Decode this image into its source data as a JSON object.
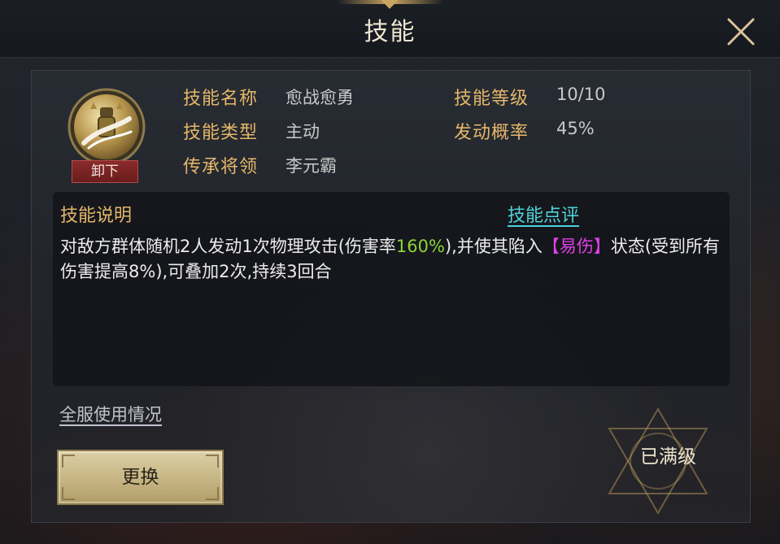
{
  "header": {
    "title": "技能"
  },
  "skill": {
    "unequip_label": "卸下",
    "fields": [
      {
        "label": "技能名称",
        "value": "愈战愈勇"
      },
      {
        "label": "技能类型",
        "value": "主动"
      },
      {
        "label": "传承将领",
        "value": "李元霸"
      },
      {
        "label": "技能等级",
        "value": "10/10"
      },
      {
        "label": "发动概率",
        "value": "45%"
      }
    ]
  },
  "description": {
    "title": "技能说明",
    "review_link": "技能点评",
    "text_parts": [
      "对敌方群体随机2人发动1次物理攻击(伤害率",
      "160%",
      "),并使其陷入",
      "【易伤】",
      "状态(受到所有伤害提高8%),可叠加2次,持续3回合"
    ]
  },
  "footer": {
    "usage_link": "全服使用情况",
    "change_button": "更换",
    "maxed_label": "已满级"
  },
  "colors": {
    "label_gold": "#e5b76a",
    "link_cyan": "#4fd2d8",
    "highlight_green": "#8ed33a",
    "highlight_pink": "#e040e8"
  }
}
